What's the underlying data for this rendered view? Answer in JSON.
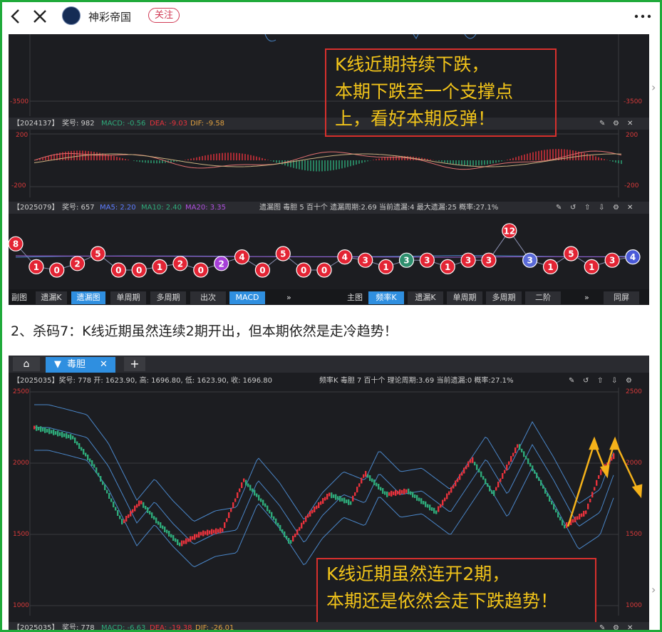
{
  "header": {
    "account_name": "神彩帝国",
    "follow_label": "关注"
  },
  "panel1": {
    "axis_top_left": "-3500",
    "axis_top_right": "-3500",
    "callout_lines": [
      "K线近期持续下跌，",
      "本期下跌至一个支撑点",
      "上，看好本期反弹！"
    ],
    "macd_strip": {
      "id": "【2024137】",
      "prize": "奖号: 982",
      "macd": "MACD: -0.56",
      "dea": "DEA: -9.03",
      "dif": "DIF: -9.58"
    },
    "macd_axis": {
      "top_left": "200",
      "top_right": "200",
      "bottom_left": "-200",
      "bottom_right": "-200"
    },
    "miss_strip": {
      "id": "【2025079】",
      "prize": "奖号: 657",
      "ma5": "MA5: 2.20",
      "ma10": "MA10: 2.40",
      "ma20": "MA20: 3.35",
      "info": "遗漏图  毒胆  5  百十个  遗漏周期:2.69  当前遗漏:4  最大遗漏:25  概率:27.1%"
    },
    "miss_values": [
      8,
      1,
      0,
      2,
      5,
      0,
      0,
      1,
      2,
      0,
      2,
      4,
      0,
      5,
      0,
      0,
      4,
      3,
      1,
      3,
      3,
      1,
      3,
      3,
      12,
      3,
      1,
      5,
      1,
      3,
      4
    ],
    "toolbar": {
      "left_label": "副图",
      "buttons_left": [
        "遗漏K",
        "遗漏图",
        "单周期",
        "多周期",
        "出次",
        "MACD"
      ],
      "more": "»",
      "right_label": "主图",
      "buttons_right": [
        "频率K",
        "遗漏K",
        "单周期",
        "多周期",
        "二阶"
      ],
      "more2": "»",
      "fullscreen": "同屏"
    }
  },
  "caption": "2、杀码7：K线近期虽然连续2期开出，但本期依然是走冷趋势！",
  "panel2": {
    "tab_label": "毒胆",
    "info_strip": {
      "left": "【2025035】奖号: 778  开: 1623.90, 高: 1696.80, 低: 1623.90, 收: 1696.80",
      "right": "频率K  毒胆  7  百十个  理论周期:3.69  当前遗漏:0  概率:27.1%"
    },
    "axis_left": [
      "2500",
      "2000",
      "1500",
      "1000"
    ],
    "axis_right": [
      "2500",
      "2000",
      "1500",
      "1000"
    ],
    "callout_lines": [
      "K线近期虽然连开2期，",
      "本期还是依然会走下跌趋势！"
    ],
    "bottom_strip": {
      "id": "【2025035】",
      "prize": "奖号: 778",
      "macd": "MACD: -6.63",
      "dea": "DEA: -19.38",
      "dif": "DIF: -26.01"
    }
  },
  "colors": {
    "frame": "#1faa3a",
    "up": "#e8323c",
    "down": "#2eaa7a",
    "band": "#4a86c8",
    "accent": "#2f8fe0",
    "callout_border": "#d8302d",
    "callout_text": "#f2c41a",
    "arrow": "#f5b21a"
  },
  "icons": [
    "back-icon",
    "close-icon",
    "more-icon",
    "pin-icon",
    "gear-icon",
    "home-icon",
    "plus-icon",
    "arrow-up-icon",
    "arrow-down-icon",
    "refresh-icon"
  ]
}
